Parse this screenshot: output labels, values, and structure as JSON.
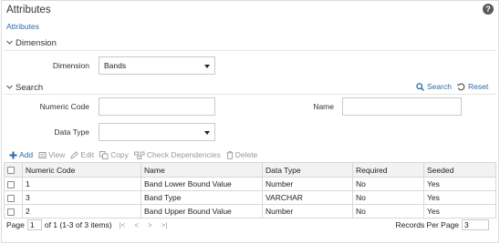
{
  "header": {
    "title": "Attributes",
    "help_icon": "?"
  },
  "breadcrumb": "Attributes",
  "dimension_section": {
    "title": "Dimension",
    "dimension_label": "Dimension",
    "dimension_value": "Bands"
  },
  "search_section": {
    "title": "Search",
    "search_label": "Search",
    "reset_label": "Reset",
    "numeric_code_label": "Numeric Code",
    "numeric_code_value": "",
    "name_label": "Name",
    "name_value": "",
    "data_type_label": "Data Type",
    "data_type_value": ""
  },
  "toolbar": {
    "add": "Add",
    "view": "View",
    "edit": "Edit",
    "copy": "Copy",
    "check_dependencies": "Check Dependencies",
    "delete": "Delete"
  },
  "table": {
    "columns": [
      "Numeric Code",
      "Name",
      "Data Type",
      "Required",
      "Seeded"
    ],
    "rows": [
      [
        "1",
        "Band Lower Bound Value",
        "Number",
        "No",
        "Yes"
      ],
      [
        "3",
        "Band Type",
        "VARCHAR",
        "No",
        "Yes"
      ],
      [
        "2",
        "Band Upper Bound Value",
        "Number",
        "No",
        "Yes"
      ]
    ]
  },
  "pagination": {
    "page_label": "Page",
    "page_value": "1",
    "of_text": "of 1 (1-3 of 3 items)",
    "records_label": "Records Per Page",
    "records_value": "3"
  },
  "colors": {
    "link": "#2b6aa6",
    "header_bg": "#f2f2f2",
    "disabled": "#9a9a9a"
  }
}
